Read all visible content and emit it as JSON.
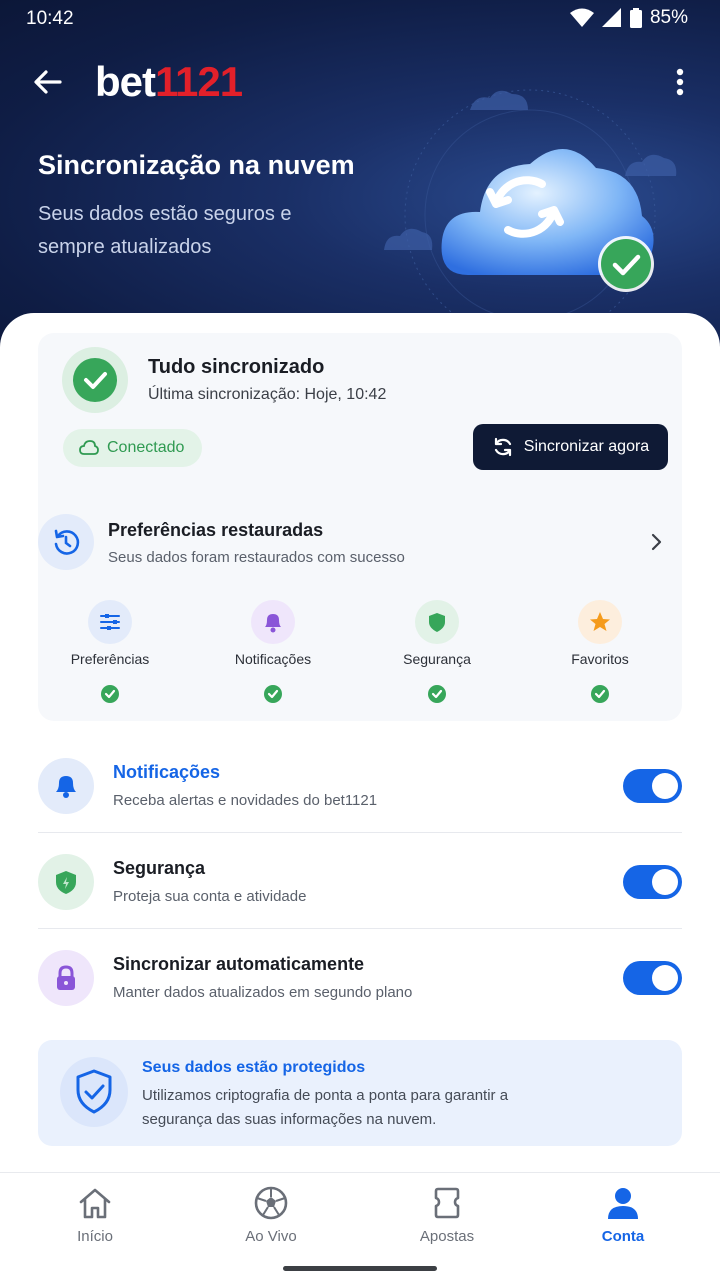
{
  "status": {
    "time": "10:42",
    "battery": "85%"
  },
  "appbar": {
    "logo_white": "bet",
    "logo_red": "1121"
  },
  "hero": {
    "title": "Sincronização na nuvem",
    "subtitle": "Seus dados estão seguros e sempre atualizados"
  },
  "sync": {
    "title": "Tudo sincronizado",
    "last_sync": "Última sincronização: Hoje, 10:42",
    "status_chip": "Conectado",
    "button": "Sincronizar agora"
  },
  "restored": {
    "title": "Preferências restauradas",
    "subtitle": "Seus dados foram restaurados com sucesso",
    "items": [
      {
        "label": "Preferências",
        "icon": "sliders-icon"
      },
      {
        "label": "Notificações",
        "icon": "bell-icon"
      },
      {
        "label": "Segurança",
        "icon": "shield-icon"
      },
      {
        "label": "Favoritos",
        "icon": "star-icon"
      }
    ]
  },
  "settings": [
    {
      "title": "Notificações",
      "subtitle": "Receba alertas e novidades do bet1121",
      "enabled": true,
      "icon": "bell-icon",
      "title_color": "#1565e6"
    },
    {
      "title": "Segurança",
      "subtitle": "Proteja sua conta e atividade",
      "enabled": true,
      "icon": "shield-icon"
    },
    {
      "title": "Sincronizar automaticamente",
      "subtitle": "Manter dados atualizados em segundo plano",
      "enabled": true,
      "icon": "lock-icon"
    }
  ],
  "protection": {
    "title": "Seus dados estão protegidos",
    "text": "Utilizamos criptografia de ponta a ponta para garantir a segurança das suas informações na nuvem."
  },
  "nav": {
    "tabs": [
      {
        "label": "Início",
        "icon": "home-icon"
      },
      {
        "label": "Ao Vivo",
        "icon": "soccer-ball-icon"
      },
      {
        "label": "Apostas",
        "icon": "ticket-icon"
      },
      {
        "label": "Conta",
        "icon": "user-icon",
        "active": true
      }
    ]
  },
  "colors": {
    "accent": "#1565e6",
    "brand_red": "#e2202a",
    "success": "#37a65a",
    "dark": "#0f1a35"
  }
}
